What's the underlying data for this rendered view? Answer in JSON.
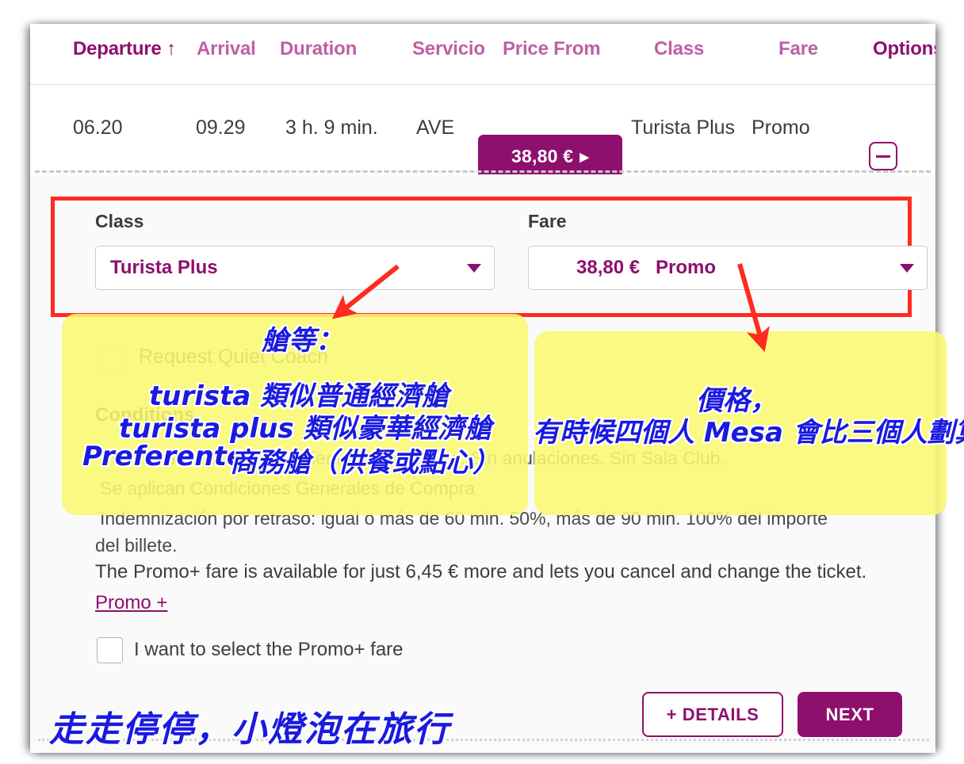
{
  "table": {
    "headers": [
      {
        "label": "Departure ↑",
        "emphasis": "strong"
      },
      {
        "label": "Arrival",
        "emphasis": "soft"
      },
      {
        "label": "Duration",
        "emphasis": "soft"
      },
      {
        "label": "Servicio",
        "emphasis": "soft"
      },
      {
        "label": "Price From",
        "emphasis": "soft"
      },
      {
        "label": "Class",
        "emphasis": "soft"
      },
      {
        "label": "Fare",
        "emphasis": "soft"
      },
      {
        "label": "Options",
        "emphasis": "strong"
      }
    ],
    "row": {
      "departure": "06.20",
      "arrival": "09.29",
      "duration": "3 h. 9 min.",
      "service": "AVE",
      "price": "38,80 €",
      "price_arrow": "▶",
      "class": "Turista Plus",
      "fare": "Promo"
    }
  },
  "detail": {
    "class_label": "Class",
    "class_value": "Turista Plus",
    "fare_label": "Fare",
    "fare_price": "38,80 €",
    "fare_name": "Promo",
    "quiet_coach_label": "Request Quiet Coach",
    "conditions_title": "Conditions",
    "conditions": [
      "Promo:  Sin elección de asiento.  Sin cambios.  Sin anulaciones.  Sin Sala Club.",
      "Se aplican Condiciones Generales de Compra",
      "Indemnización por retraso: igual o más de 60 min. 50%, más de 90 min. 100% del importe",
      "del billete."
    ],
    "promo_plus_text": "The Promo+ fare is available for just 6,45 € more and lets you cancel and change the ticket.",
    "promo_plus_link": "Promo +",
    "promo_plus_checkbox_label": "I want to select the Promo+ fare",
    "details_button": "+ DETAILS",
    "next_button": "NEXT"
  },
  "annotations": {
    "left": [
      "艙等：",
      "turista 類似普通經濟艙",
      "turista plus 類似豪華經濟艙",
      "Preferente",
      "商務艙（供餐或點心）"
    ],
    "right": [
      "價格，",
      "有時候四個人 Mesa 會比三個人劃算"
    ],
    "watermark": "走走停停，小燈泡在旅行"
  },
  "colors": {
    "brand_purple": "#8e0f6e",
    "brand_purple_soft": "#bf5fa5",
    "highlight_yellow": "#f9f871",
    "ink_blue": "#1a1ae0",
    "annotation_red": "#ff2b20"
  }
}
